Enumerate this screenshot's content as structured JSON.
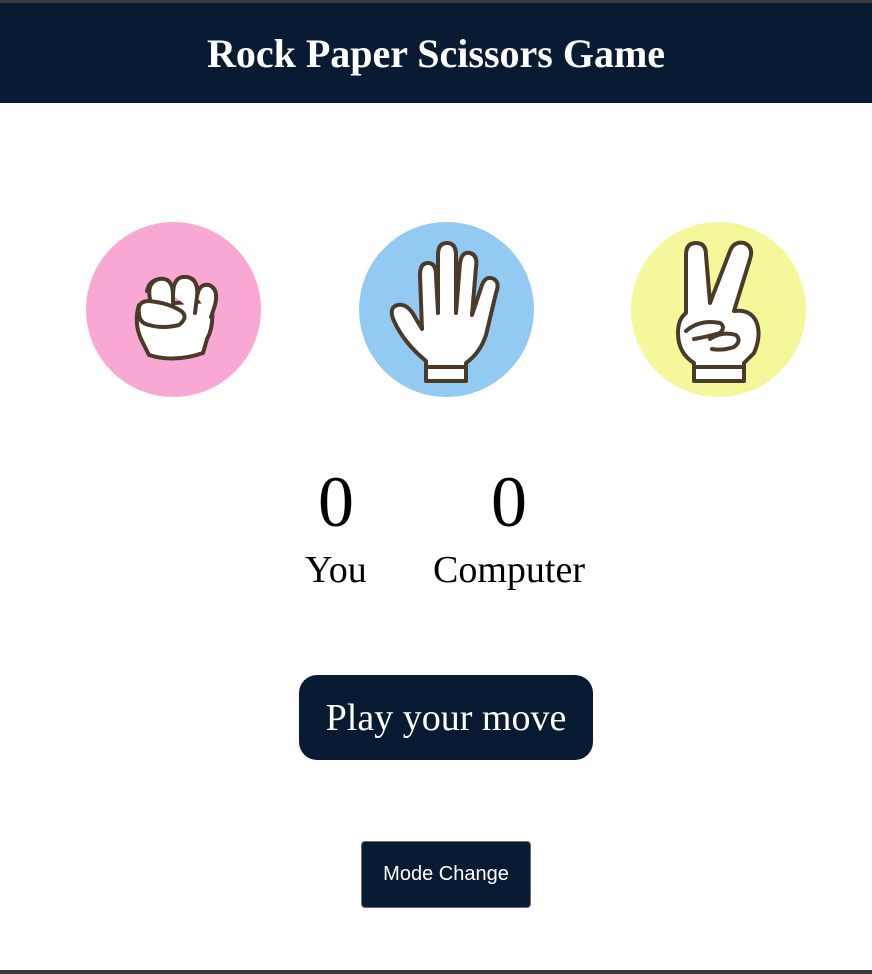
{
  "header": {
    "title": "Rock Paper Scissors Game"
  },
  "choices": [
    {
      "id": "rock",
      "icon": "fist-hand-icon",
      "bg_color": "#f9a7d3"
    },
    {
      "id": "paper",
      "icon": "open-hand-icon",
      "bg_color": "#93caf1"
    },
    {
      "id": "scissors",
      "icon": "victory-hand-icon",
      "bg_color": "#f4f79a"
    }
  ],
  "score": {
    "user_value": "0",
    "user_label": "You",
    "computer_value": "0",
    "computer_label": "Computer"
  },
  "message": {
    "text": "Play your move"
  },
  "mode_button": {
    "label": "Mode Change"
  },
  "colors": {
    "header_bg": "#081b33",
    "header_text": "#ffffff",
    "msg_bg": "#081b33"
  }
}
